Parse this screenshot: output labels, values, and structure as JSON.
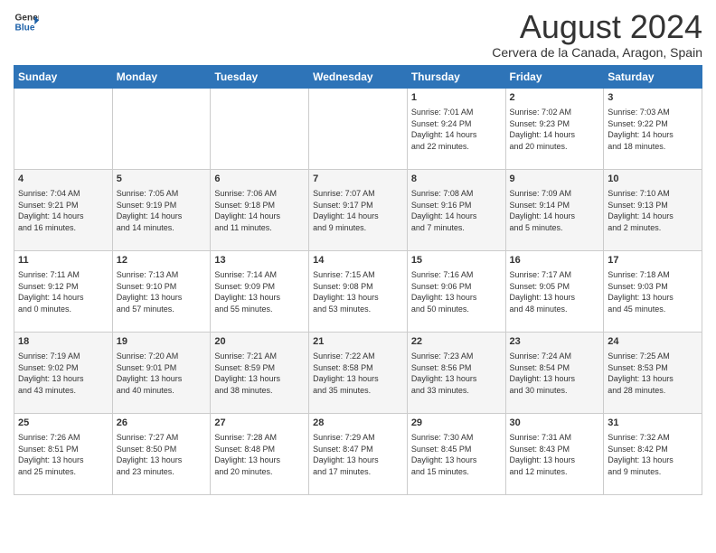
{
  "header": {
    "logo_line1": "General",
    "logo_line2": "Blue",
    "month": "August 2024",
    "location": "Cervera de la Canada, Aragon, Spain"
  },
  "weekdays": [
    "Sunday",
    "Monday",
    "Tuesday",
    "Wednesday",
    "Thursday",
    "Friday",
    "Saturday"
  ],
  "weeks": [
    [
      {
        "day": "",
        "info": ""
      },
      {
        "day": "",
        "info": ""
      },
      {
        "day": "",
        "info": ""
      },
      {
        "day": "",
        "info": ""
      },
      {
        "day": "1",
        "info": "Sunrise: 7:01 AM\nSunset: 9:24 PM\nDaylight: 14 hours\nand 22 minutes."
      },
      {
        "day": "2",
        "info": "Sunrise: 7:02 AM\nSunset: 9:23 PM\nDaylight: 14 hours\nand 20 minutes."
      },
      {
        "day": "3",
        "info": "Sunrise: 7:03 AM\nSunset: 9:22 PM\nDaylight: 14 hours\nand 18 minutes."
      }
    ],
    [
      {
        "day": "4",
        "info": "Sunrise: 7:04 AM\nSunset: 9:21 PM\nDaylight: 14 hours\nand 16 minutes."
      },
      {
        "day": "5",
        "info": "Sunrise: 7:05 AM\nSunset: 9:19 PM\nDaylight: 14 hours\nand 14 minutes."
      },
      {
        "day": "6",
        "info": "Sunrise: 7:06 AM\nSunset: 9:18 PM\nDaylight: 14 hours\nand 11 minutes."
      },
      {
        "day": "7",
        "info": "Sunrise: 7:07 AM\nSunset: 9:17 PM\nDaylight: 14 hours\nand 9 minutes."
      },
      {
        "day": "8",
        "info": "Sunrise: 7:08 AM\nSunset: 9:16 PM\nDaylight: 14 hours\nand 7 minutes."
      },
      {
        "day": "9",
        "info": "Sunrise: 7:09 AM\nSunset: 9:14 PM\nDaylight: 14 hours\nand 5 minutes."
      },
      {
        "day": "10",
        "info": "Sunrise: 7:10 AM\nSunset: 9:13 PM\nDaylight: 14 hours\nand 2 minutes."
      }
    ],
    [
      {
        "day": "11",
        "info": "Sunrise: 7:11 AM\nSunset: 9:12 PM\nDaylight: 14 hours\nand 0 minutes."
      },
      {
        "day": "12",
        "info": "Sunrise: 7:13 AM\nSunset: 9:10 PM\nDaylight: 13 hours\nand 57 minutes."
      },
      {
        "day": "13",
        "info": "Sunrise: 7:14 AM\nSunset: 9:09 PM\nDaylight: 13 hours\nand 55 minutes."
      },
      {
        "day": "14",
        "info": "Sunrise: 7:15 AM\nSunset: 9:08 PM\nDaylight: 13 hours\nand 53 minutes."
      },
      {
        "day": "15",
        "info": "Sunrise: 7:16 AM\nSunset: 9:06 PM\nDaylight: 13 hours\nand 50 minutes."
      },
      {
        "day": "16",
        "info": "Sunrise: 7:17 AM\nSunset: 9:05 PM\nDaylight: 13 hours\nand 48 minutes."
      },
      {
        "day": "17",
        "info": "Sunrise: 7:18 AM\nSunset: 9:03 PM\nDaylight: 13 hours\nand 45 minutes."
      }
    ],
    [
      {
        "day": "18",
        "info": "Sunrise: 7:19 AM\nSunset: 9:02 PM\nDaylight: 13 hours\nand 43 minutes."
      },
      {
        "day": "19",
        "info": "Sunrise: 7:20 AM\nSunset: 9:01 PM\nDaylight: 13 hours\nand 40 minutes."
      },
      {
        "day": "20",
        "info": "Sunrise: 7:21 AM\nSunset: 8:59 PM\nDaylight: 13 hours\nand 38 minutes."
      },
      {
        "day": "21",
        "info": "Sunrise: 7:22 AM\nSunset: 8:58 PM\nDaylight: 13 hours\nand 35 minutes."
      },
      {
        "day": "22",
        "info": "Sunrise: 7:23 AM\nSunset: 8:56 PM\nDaylight: 13 hours\nand 33 minutes."
      },
      {
        "day": "23",
        "info": "Sunrise: 7:24 AM\nSunset: 8:54 PM\nDaylight: 13 hours\nand 30 minutes."
      },
      {
        "day": "24",
        "info": "Sunrise: 7:25 AM\nSunset: 8:53 PM\nDaylight: 13 hours\nand 28 minutes."
      }
    ],
    [
      {
        "day": "25",
        "info": "Sunrise: 7:26 AM\nSunset: 8:51 PM\nDaylight: 13 hours\nand 25 minutes."
      },
      {
        "day": "26",
        "info": "Sunrise: 7:27 AM\nSunset: 8:50 PM\nDaylight: 13 hours\nand 23 minutes."
      },
      {
        "day": "27",
        "info": "Sunrise: 7:28 AM\nSunset: 8:48 PM\nDaylight: 13 hours\nand 20 minutes."
      },
      {
        "day": "28",
        "info": "Sunrise: 7:29 AM\nSunset: 8:47 PM\nDaylight: 13 hours\nand 17 minutes."
      },
      {
        "day": "29",
        "info": "Sunrise: 7:30 AM\nSunset: 8:45 PM\nDaylight: 13 hours\nand 15 minutes."
      },
      {
        "day": "30",
        "info": "Sunrise: 7:31 AM\nSunset: 8:43 PM\nDaylight: 13 hours\nand 12 minutes."
      },
      {
        "day": "31",
        "info": "Sunrise: 7:32 AM\nSunset: 8:42 PM\nDaylight: 13 hours\nand 9 minutes."
      }
    ]
  ]
}
